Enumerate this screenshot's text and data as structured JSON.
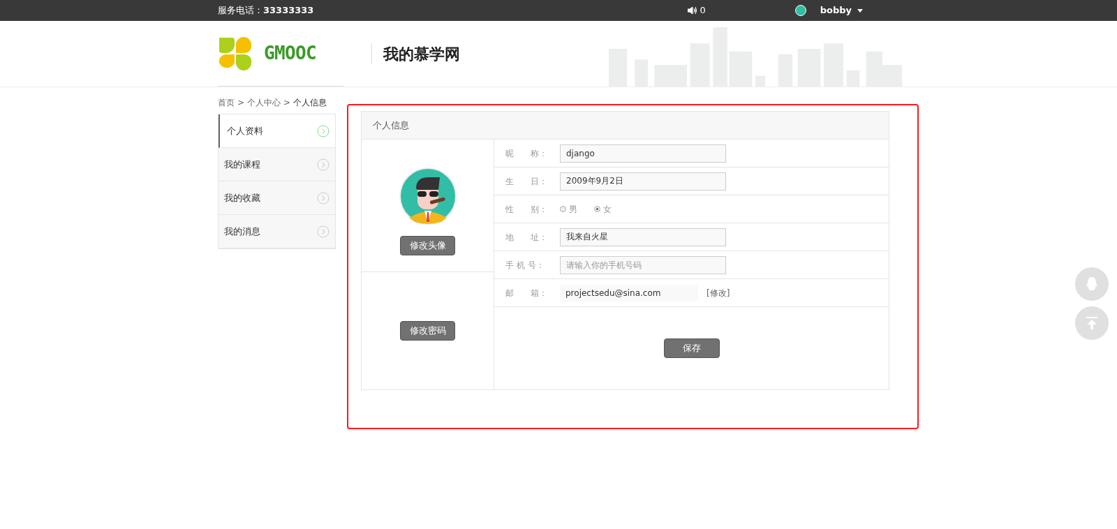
{
  "topbar": {
    "phone_label": "服务电话：",
    "phone": "33333333",
    "notifications": "0",
    "user": "bobby"
  },
  "header": {
    "logo_text": "GMOOC",
    "title": "我的慕学网"
  },
  "breadcrumb": [
    "首页",
    "个人中心",
    "个人信息"
  ],
  "breadcrumb_separator": ">",
  "sidebar": {
    "items": [
      {
        "label": "个人资料",
        "selected": true
      },
      {
        "label": "我的课程",
        "selected": false
      },
      {
        "label": "我的收藏",
        "selected": false
      },
      {
        "label": "我的消息",
        "selected": false
      }
    ]
  },
  "panel": {
    "title": "个人信息",
    "avatar_button": "修改头像",
    "password_button": "修改密码",
    "fields": [
      {
        "kind": "input",
        "label": "昵　　称：",
        "value": "django"
      },
      {
        "kind": "input",
        "label": "生　　日：",
        "value": "2009年9月2日"
      },
      {
        "kind": "radio",
        "label": "性　　别：",
        "options": [
          {
            "label": "男",
            "selected": false
          },
          {
            "label": "女",
            "selected": true
          }
        ]
      },
      {
        "kind": "input",
        "label": "地　　址：",
        "value": "我来自火星"
      },
      {
        "kind": "input",
        "label": "手 机 号：",
        "placeholder": "请输入你的手机号码"
      },
      {
        "kind": "readonly",
        "label": "邮　　箱：",
        "value": "projectsedu@sina.com",
        "link": "[修改]"
      }
    ],
    "save_button": "保存"
  }
}
